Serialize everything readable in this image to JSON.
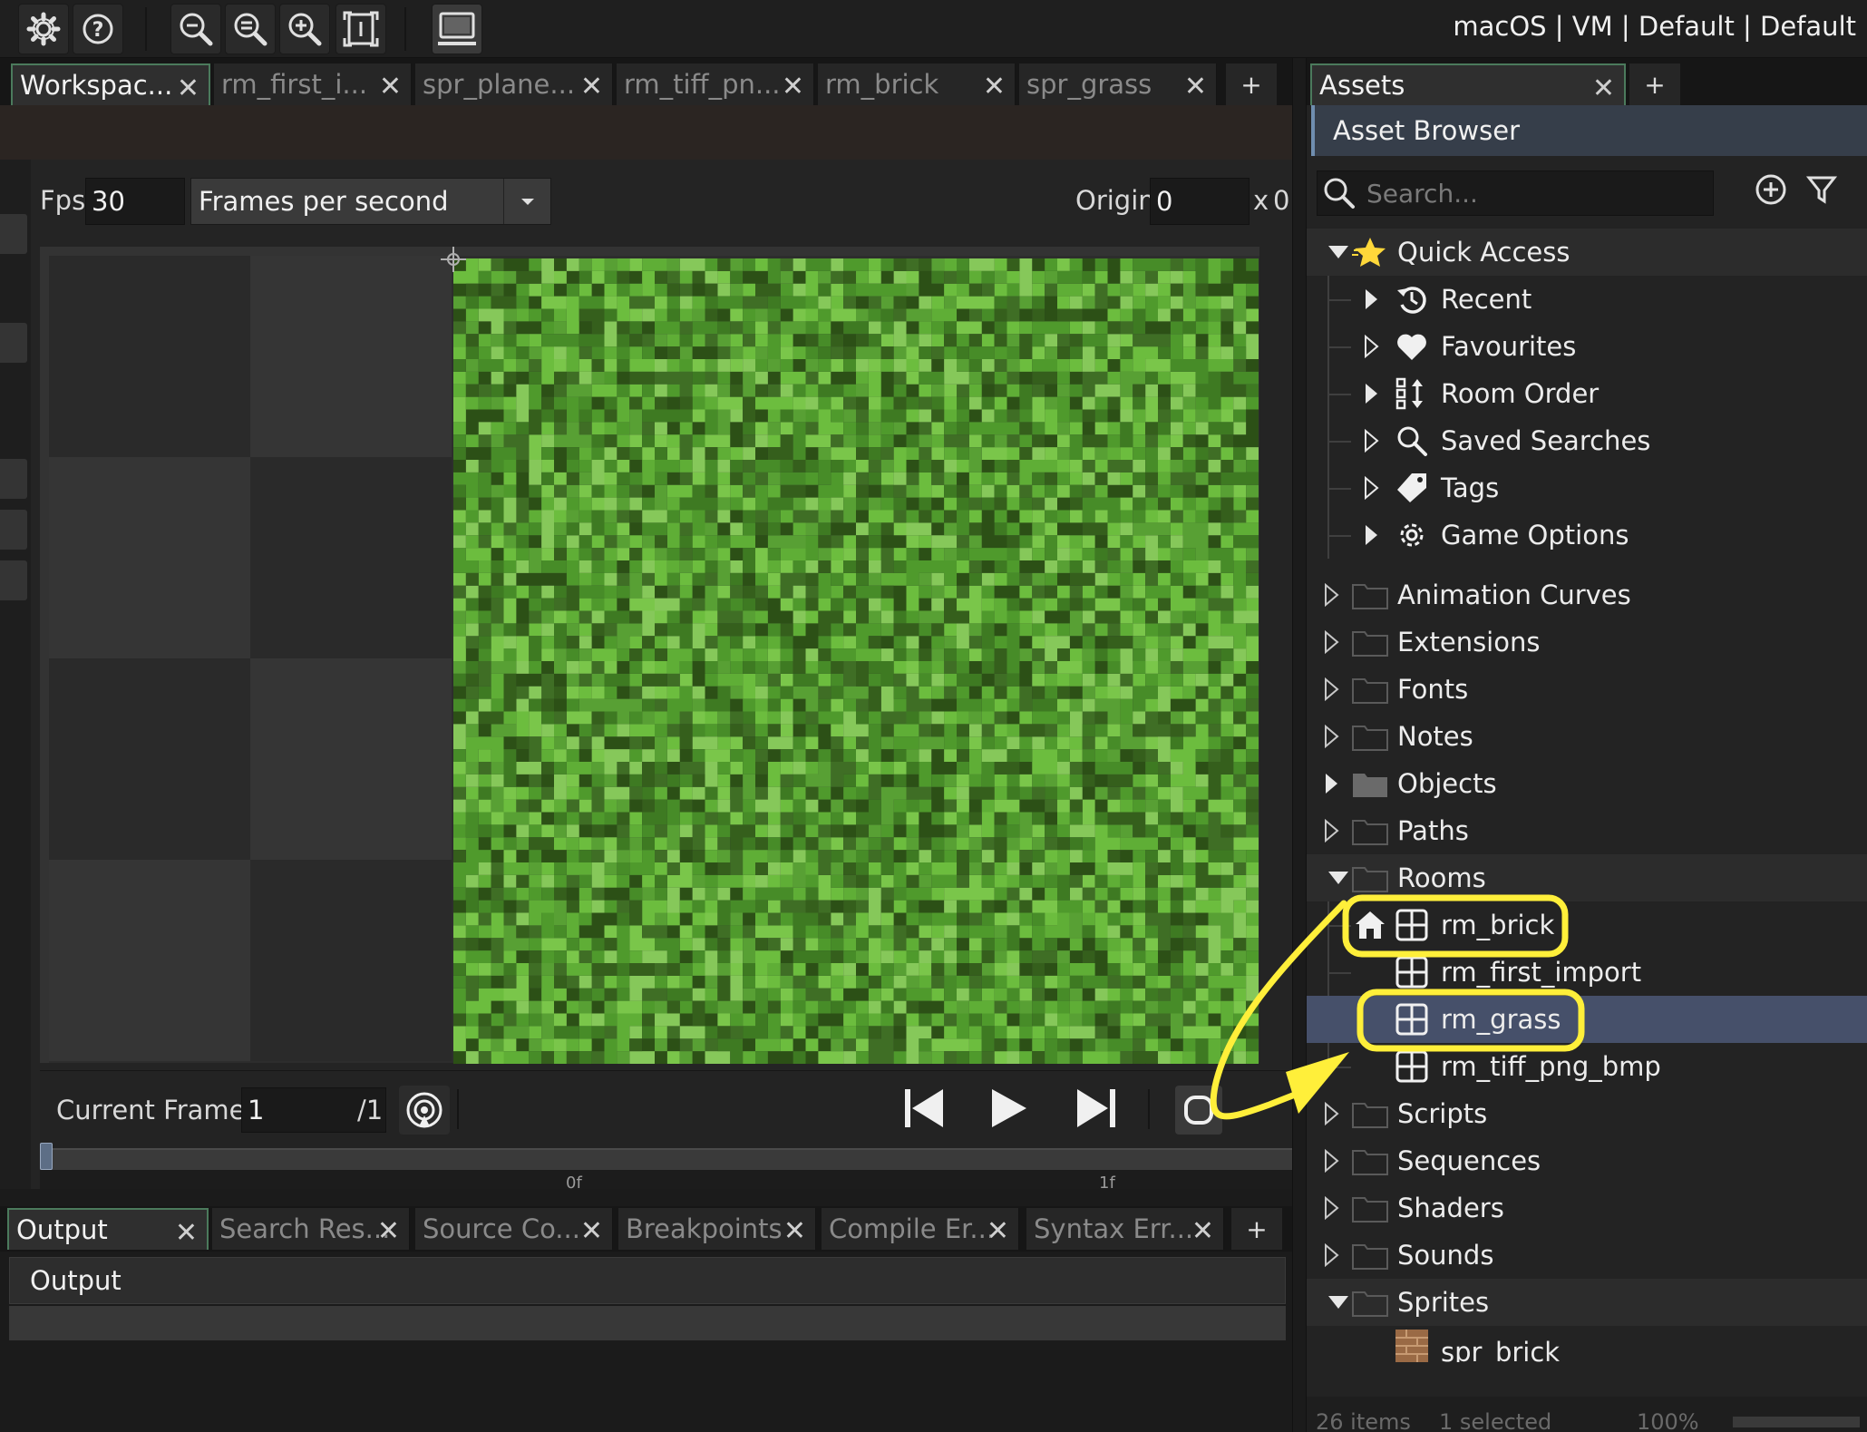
{
  "toolbar": {
    "buttons": [
      "settings-icon",
      "help-icon",
      "zoom-out-icon",
      "zoom-reset-icon",
      "zoom-in-icon",
      "fit-window-icon",
      "target-device-icon"
    ],
    "target_label": "macOS | VM | Default | Default"
  },
  "editor_tabs": [
    {
      "label": "Workspac...",
      "active": true
    },
    {
      "label": "rm_first_i...",
      "active": false
    },
    {
      "label": "spr_plane...",
      "active": false
    },
    {
      "label": "rm_tiff_pn...",
      "active": false
    },
    {
      "label": "rm_brick",
      "active": false
    },
    {
      "label": "spr_grass",
      "active": false
    }
  ],
  "tab_add": "+",
  "sprite_editor": {
    "fps_label": "Fps",
    "fps_value": "30",
    "fps_mode": "Frames per second",
    "origin_label": "Origin",
    "origin_x": "0",
    "origin_sep": "x",
    "origin_y": "0",
    "current_frame_label": "Current Frame:",
    "current_frame_value": "1",
    "frame_total": "/1",
    "timeline_ticks": [
      "0f",
      "1f"
    ]
  },
  "output_tabs": [
    {
      "label": "Output",
      "active": true
    },
    {
      "label": "Search Res...",
      "active": false
    },
    {
      "label": "Source Co...",
      "active": false
    },
    {
      "label": "Breakpoints",
      "active": false
    },
    {
      "label": "Compile Er...",
      "active": false
    },
    {
      "label": "Syntax Err...",
      "active": false
    }
  ],
  "output": {
    "header": "Output"
  },
  "assets": {
    "tab_label": "Assets",
    "title": "Asset Browser",
    "search_placeholder": "Search...",
    "quick_access": {
      "label": "Quick Access",
      "items": [
        "Recent",
        "Favourites",
        "Room Order",
        "Saved Searches",
        "Tags",
        "Game Options"
      ]
    },
    "groups": [
      "Animation Curves",
      "Extensions",
      "Fonts",
      "Notes",
      "Objects",
      "Paths"
    ],
    "rooms_label": "Rooms",
    "rooms": [
      "rm_brick",
      "rm_first_import",
      "rm_grass",
      "rm_tiff_png_bmp"
    ],
    "groups_after": [
      "Scripts",
      "Sequences",
      "Shaders",
      "Sounds"
    ],
    "sprites_label": "Sprites",
    "sprites": [
      "spr_brick"
    ],
    "status": {
      "items": "26 items",
      "selected": "1 selected",
      "zoom": "100%"
    }
  },
  "colors": {
    "accent": "#ffef3a",
    "selection": "#46506a",
    "grass": "#4f9a2c"
  }
}
